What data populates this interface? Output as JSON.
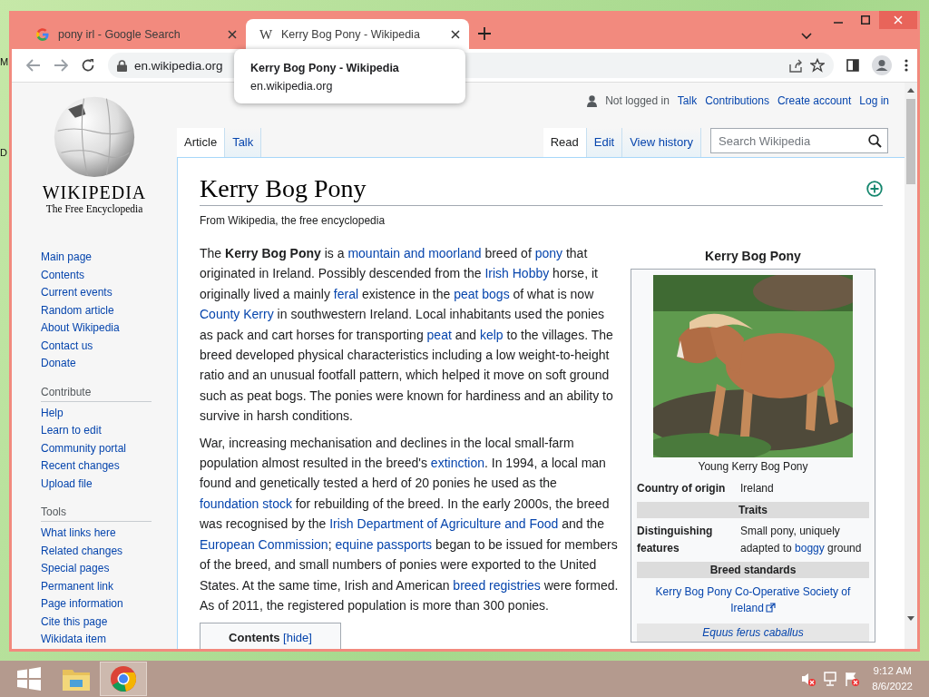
{
  "desktop": {
    "edge_labels": [
      "M",
      "D"
    ]
  },
  "browser": {
    "tabs": [
      {
        "title": "pony irl - Google Search",
        "kind": "google",
        "selected": false
      },
      {
        "title": "Kerry Bog Pony - Wikipedia",
        "kind": "letter",
        "favicon_text": "W",
        "selected": true
      }
    ],
    "address": "en.wikipedia.org",
    "tooltip": {
      "title": "Kerry Bog Pony - Wikipedia",
      "url": "en.wikipedia.org"
    }
  },
  "wiki": {
    "logo": {
      "wordmark": "WIKIPEDIA",
      "tagline": "The Free Encyclopedia"
    },
    "sidebar": {
      "navigation": [
        "Main page",
        "Contents",
        "Current events",
        "Random article",
        "About Wikipedia",
        "Contact us",
        "Donate"
      ],
      "sections": [
        {
          "heading": "Contribute",
          "items": [
            "Help",
            "Learn to edit",
            "Community portal",
            "Recent changes",
            "Upload file"
          ]
        },
        {
          "heading": "Tools",
          "items": [
            "What links here",
            "Related changes",
            "Special pages",
            "Permanent link",
            "Page information",
            "Cite this page",
            "Wikidata item"
          ]
        }
      ]
    },
    "user_status": "Not logged in",
    "personal_links": [
      "Talk",
      "Contributions",
      "Create account",
      "Log in"
    ],
    "page_tabs": [
      {
        "label": "Article",
        "selected": true
      },
      {
        "label": "Talk",
        "selected": false
      }
    ],
    "view_tabs": [
      {
        "label": "Read",
        "selected": true
      },
      {
        "label": "Edit",
        "selected": false
      },
      {
        "label": "View history",
        "selected": false
      }
    ],
    "search": {
      "placeholder": "Search Wikipedia"
    },
    "title": "Kerry Bog Pony",
    "tagline": "From Wikipedia, the free encyclopedia",
    "paragraphs": [
      [
        {
          "kind": "text",
          "text": "The "
        },
        {
          "kind": "bold",
          "text": "Kerry Bog Pony"
        },
        {
          "kind": "text",
          "text": " is a "
        },
        {
          "kind": "link",
          "text": "mountain and moorland"
        },
        {
          "kind": "text",
          "text": " breed of "
        },
        {
          "kind": "link",
          "text": "pony"
        },
        {
          "kind": "text",
          "text": " that originated in Ireland. Possibly descended from the "
        },
        {
          "kind": "link",
          "text": "Irish Hobby"
        },
        {
          "kind": "text",
          "text": " horse, it originally lived a mainly "
        },
        {
          "kind": "link",
          "text": "feral"
        },
        {
          "kind": "text",
          "text": " existence in the "
        },
        {
          "kind": "link",
          "text": "peat bogs"
        },
        {
          "kind": "text",
          "text": " of what is now "
        },
        {
          "kind": "link",
          "text": "County Kerry"
        },
        {
          "kind": "text",
          "text": " in southwestern Ireland. Local inhabitants used the ponies as pack and cart horses for transporting "
        },
        {
          "kind": "link",
          "text": "peat"
        },
        {
          "kind": "text",
          "text": " and "
        },
        {
          "kind": "link",
          "text": "kelp"
        },
        {
          "kind": "text",
          "text": " to the villages. The breed developed physical characteristics including a low weight-to-height ratio and an unusual footfall pattern, which helped it move on soft ground such as peat bogs. The ponies were known for hardiness and an ability to survive in harsh conditions."
        }
      ],
      [
        {
          "kind": "text",
          "text": "War, increasing mechanisation and declines in the local small-farm population almost resulted in the breed's "
        },
        {
          "kind": "link",
          "text": "extinction"
        },
        {
          "kind": "text",
          "text": ". In 1994, a local man found and genetically tested a herd of 20 ponies he used as the "
        },
        {
          "kind": "link",
          "text": "foundation stock"
        },
        {
          "kind": "text",
          "text": " for rebuilding of the breed. In the early 2000s, the breed was recognised by the "
        },
        {
          "kind": "link",
          "text": "Irish Department of Agriculture and Food"
        },
        {
          "kind": "text",
          "text": " and the "
        },
        {
          "kind": "link",
          "text": "European Commission"
        },
        {
          "kind": "text",
          "text": "; "
        },
        {
          "kind": "link",
          "text": "equine passports"
        },
        {
          "kind": "text",
          "text": " began to be issued for members of the breed, and small numbers of ponies were exported to the United States. At the same time, Irish and American "
        },
        {
          "kind": "link",
          "text": "breed registries"
        },
        {
          "kind": "text",
          "text": " were formed. As of 2011, the registered population is more than 300 ponies."
        }
      ]
    ],
    "contents_box": {
      "title": "Contents",
      "toggle": "[hide]"
    },
    "infobox": {
      "title": "Kerry Bog Pony",
      "caption": "Young Kerry Bog Pony",
      "rows": [
        {
          "kind": "data",
          "label": "Country of origin",
          "value": [
            {
              "kind": "text",
              "text": "Ireland"
            }
          ]
        },
        {
          "kind": "header",
          "text": "Traits"
        },
        {
          "kind": "data",
          "label": "Distinguishing features",
          "value": [
            {
              "kind": "text",
              "text": "Small pony, uniquely adapted to "
            },
            {
              "kind": "link",
              "text": "boggy"
            },
            {
              "kind": "text",
              "text": " ground"
            }
          ]
        },
        {
          "kind": "header",
          "text": "Breed standards"
        },
        {
          "kind": "link",
          "text": "Kerry Bog Pony Co-Operative Society of Ireland"
        },
        {
          "kind": "taxon",
          "text": "Equus ferus caballus"
        }
      ]
    }
  },
  "taskbar": {
    "apps": [
      {
        "kind": "explorer",
        "selected": false
      },
      {
        "kind": "chrome",
        "selected": true
      }
    ],
    "time": "9:12 AM",
    "date": "8/6/2022"
  }
}
